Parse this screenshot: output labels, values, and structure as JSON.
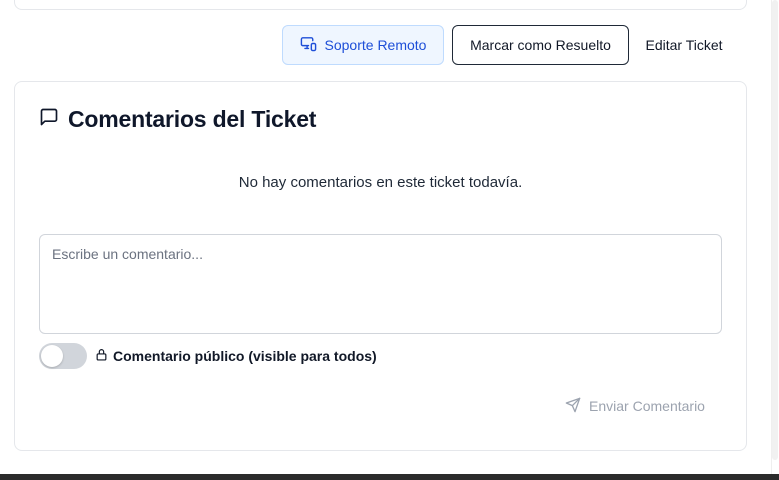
{
  "actions": {
    "remote_support_label": "Soporte Remoto",
    "mark_resolved_label": "Marcar como Resuelto",
    "edit_ticket_label": "Editar Ticket"
  },
  "comments": {
    "title": "Comentarios del Ticket",
    "empty_message": "No hay comentarios en este ticket todavía.",
    "input_placeholder": "Escribe un comentario...",
    "input_value": "",
    "public_toggle_label": "Comentario público (visible para todos)",
    "public_toggle_on": false,
    "send_label": "Enviar Comentario"
  },
  "icons": {
    "remote": "monitor-smartphone-icon",
    "comments": "message-square-icon",
    "lock": "lock-icon",
    "send": "send-icon"
  },
  "colors": {
    "remote_button_bg": "#eff6ff",
    "remote_button_text": "#1d4ed8",
    "disabled_text": "#9ca3af",
    "border": "#e5e7eb"
  }
}
